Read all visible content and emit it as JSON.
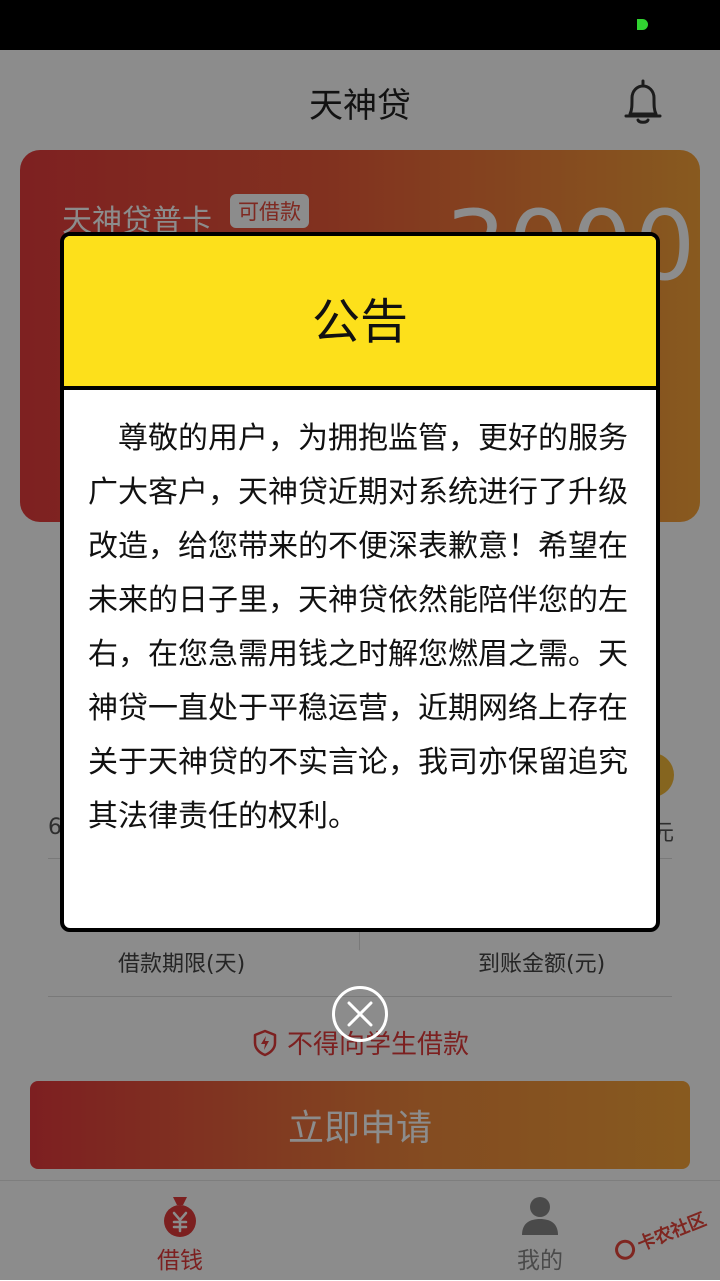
{
  "header": {
    "title": "天神贷"
  },
  "card": {
    "title": "天神贷普卡",
    "badge": "可借款",
    "amount": "3000"
  },
  "loan": {
    "left_value": "6",
    "right_unit": "元",
    "term_label": "借款期限(天)",
    "arrival_label": "到账金额(元)",
    "warning": "不得向学生借款",
    "apply_label": "立即申请"
  },
  "tabs": [
    {
      "label": "借钱",
      "active": true
    },
    {
      "label": "我的",
      "active": false
    }
  ],
  "watermark": {
    "text": "卡农社区"
  },
  "modal": {
    "title": "公告",
    "body": "尊敬的用户，为拥抱监管，更好的服务广大客户，天神贷近期对系统进行了升级改造，给您带来的不便深表歉意！希望在未来的日子里，天神贷依然能陪伴您的左右，在您急需用钱之时解您燃眉之需。天神贷一直处于平稳运营，近期网络上存在关于天神贷的不实言论，我司亦保留追究其法律责任的权利。"
  },
  "colors": {
    "accent": "#e23b3b",
    "modal_header": "#fde01b"
  },
  "icons": [
    "bell-icon",
    "shield-icon",
    "money-bag-icon",
    "user-icon",
    "close-icon"
  ]
}
